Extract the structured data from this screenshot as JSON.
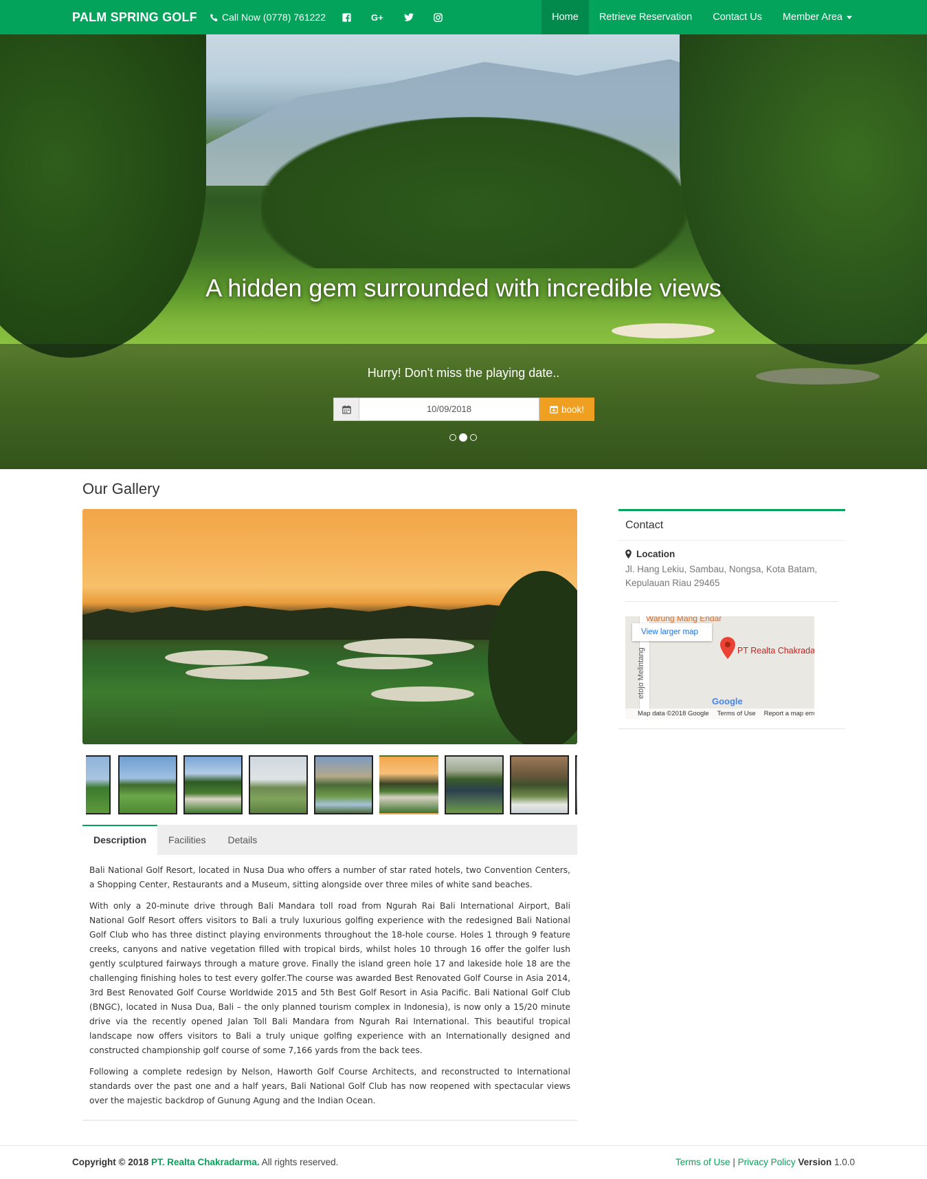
{
  "navbar": {
    "brand": "PALM SPRING GOLF",
    "phone": "Call Now (0778) 761222",
    "social": [
      "facebook-icon",
      "google-plus-icon",
      "twitter-icon",
      "instagram-icon"
    ],
    "social_labels": {
      "gplus": "G+"
    },
    "items": [
      {
        "label": "Home",
        "active": true
      },
      {
        "label": "Retrieve Reservation"
      },
      {
        "label": "Contact Us"
      },
      {
        "label": "Member Area",
        "dropdown": true
      }
    ],
    "color": "#03a35b"
  },
  "hero": {
    "title": "A hidden gem surrounded with incredible views",
    "subtitle": "Hurry! Don't miss the playing date..",
    "date_value": "10/09/2018",
    "book_label": "book!",
    "book_color": "#f0a020",
    "carousel_active_index": 1,
    "carousel_count": 3
  },
  "gallery": {
    "title": "Our Gallery",
    "thumbnail_count": 9
  },
  "tabs": [
    {
      "label": "Description",
      "active": true
    },
    {
      "label": "Facilities"
    },
    {
      "label": "Details"
    }
  ],
  "description": [
    "Bali National Golf Resort, located in Nusa Dua who offers a number of star rated hotels, two Convention Centers, a Shopping Center, Restaurants and a Museum, sitting alongside over three miles of white sand beaches.",
    "With only a 20-minute drive through Bali Mandara toll road from Ngurah Rai Bali International Airport, Bali National Golf Resort offers visitors to Bali a truly luxurious golfing experience with the redesigned Bali National Golf Club who has three distinct playing environments throughout the 18-hole course. Holes 1 through 9 feature creeks, canyons and native vegetation filled with tropical birds, whilst holes 10 through 16 offer the golfer lush gently sculptured fairways through a mature grove. Finally the island green hole 17 and lakeside hole 18 are the challenging finishing holes to test every golfer.The course was awarded Best Renovated Golf Course in Asia 2014, 3rd Best Renovated Golf Course Worldwide 2015 and 5th Best Golf Resort in Asia Pacific. Bali National Golf Club (BNGC), located in Nusa Dua, Bali – the only planned tourism complex in Indonesia), is now only a 15/20 minute drive via the recently opened Jalan Toll Bali Mandara from Ngurah Rai International. This beautiful tropical landscape now offers visitors to Bali a truly unique golfing experience with an Internationally designed and constructed championship golf course of some 7,166 yards from the back tees.",
    "Following a complete redesign by Nelson, Haworth Golf Course Architects, and reconstructed to International standards over the past one and a half years, Bali National Golf Club has now reopened with spectacular views over the majestic backdrop of Gunung Agung and the Indian Ocean."
  ],
  "contact": {
    "title": "Contact",
    "location_label": "Location",
    "address": "Jl. Hang Lekiu, Sambau, Nongsa, Kota Batam, Kepulauan Riau 29465",
    "map": {
      "top_place": "Warung Mang Endar",
      "view_larger": "View larger map",
      "pin_label": "PT Realta Chakradarm",
      "road_label": "etojo Melintang",
      "google": "Google",
      "map_data": "Map data ©2018 Google",
      "terms": "Terms of Use",
      "report": "Report a map error"
    }
  },
  "footer": {
    "copyright": "Copyright © 2018",
    "company": "PT. Realta Chakradarma.",
    "rights": "All rights reserved.",
    "terms": "Terms of Use",
    "separator": "|",
    "privacy": "Privacy Policy",
    "version_label": "Version",
    "version": "1.0.0"
  }
}
